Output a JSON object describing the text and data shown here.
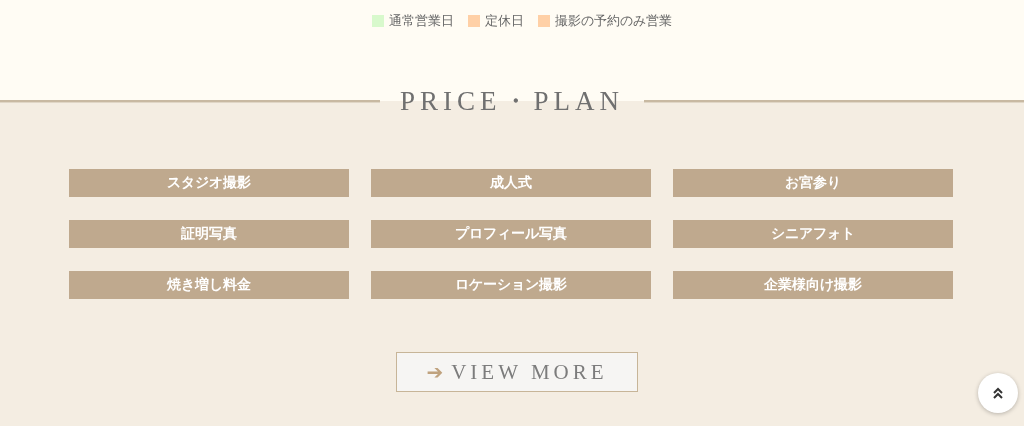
{
  "legend": [
    {
      "label": "通常営業日",
      "color": "#d8f9cc"
    },
    {
      "label": "定休日",
      "color": "#ffd0a6"
    },
    {
      "label": "撮影の予約のみ営業",
      "color": "#ffd0a6"
    }
  ],
  "heading": "PRICE・PLAN",
  "plans": [
    "スタジオ撮影",
    "成人式",
    "お宮参り",
    "証明写真",
    "プロフィール写真",
    "シニアフォト",
    "焼き増し料金",
    "ロケーション撮影",
    "企業様向け撮影"
  ],
  "view_more": {
    "arrow": "➔",
    "label": "VIEW MORE"
  }
}
